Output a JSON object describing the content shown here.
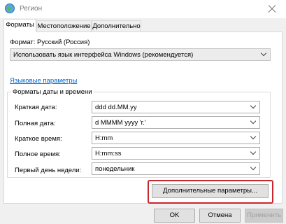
{
  "window": {
    "title": "Регион"
  },
  "tabs": [
    {
      "label": "Форматы",
      "active": true
    },
    {
      "label": "Местоположение",
      "active": false
    },
    {
      "label": "Дополнительно",
      "active": false
    }
  ],
  "format": {
    "label": "Формат: Русский (Россия)",
    "selected": "Использовать язык интерфейса Windows (рекомендуется)"
  },
  "language_link": "Языковые параметры",
  "datetime": {
    "group_title": "Форматы даты и времени",
    "rows": [
      {
        "label": "Краткая дата:",
        "value": "ddd dd.MM.yy"
      },
      {
        "label": "Полная дата:",
        "value": "d MMMM yyyy 'г.'"
      },
      {
        "label": "Краткое время:",
        "value": "H:mm"
      },
      {
        "label": "Полное время:",
        "value": "H:mm:ss"
      },
      {
        "label": "Первый день недели:",
        "value": "понедельник"
      }
    ]
  },
  "buttons": {
    "advanced": "Дополнительные параметры...",
    "ok": "OK",
    "cancel": "Отмена",
    "apply": "Применить"
  },
  "colors": {
    "link": "#0066cc",
    "highlight": "#c8262e"
  }
}
